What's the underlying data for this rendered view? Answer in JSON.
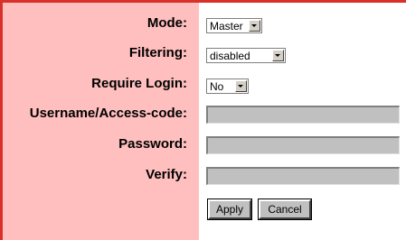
{
  "form": {
    "mode": {
      "label": "Mode:",
      "value": "Master"
    },
    "filtering": {
      "label": "Filtering:",
      "value": "disabled"
    },
    "require_login": {
      "label": "Require Login:",
      "value": "No"
    },
    "username": {
      "label": "Username/Access-code:",
      "value": ""
    },
    "password": {
      "label": "Password:",
      "value": ""
    },
    "verify": {
      "label": "Verify:",
      "value": ""
    },
    "apply_label": "Apply",
    "cancel_label": "Cancel"
  },
  "colors": {
    "label_background": "#ffbfbf",
    "border_accent": "#d9302a",
    "input_background": "#c0c0c0"
  }
}
